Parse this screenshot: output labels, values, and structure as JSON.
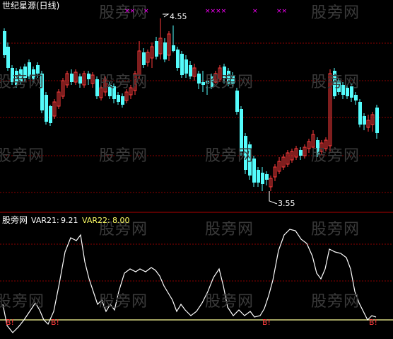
{
  "chart_title": "世纪星源(日线)",
  "watermark_text": "股旁网",
  "price_high_label": "4.55",
  "price_low_label": "3.55",
  "indicator_name": "股旁网",
  "indicator_values": {
    "var21_label": "VAR21:",
    "var21_value": "9.21",
    "var22_label": "VAR22:",
    "var22_value": "8.00"
  },
  "top_markers": [
    "××",
    "×",
    "××××",
    "×",
    "××"
  ],
  "buy_signal_text": "B!",
  "colors": {
    "background": "#000000",
    "up_candle": "#ff3c3c",
    "down_candle": "#54fcfc",
    "grid": "#8b0000",
    "title_text": "#ffffff",
    "var21": "#ffffff",
    "var22": "#ffff66",
    "marker": "#ff00ff",
    "buy_signal": "#ff3c3c",
    "indicator_line": "#ffffff",
    "baseline": "#ffff99"
  }
}
